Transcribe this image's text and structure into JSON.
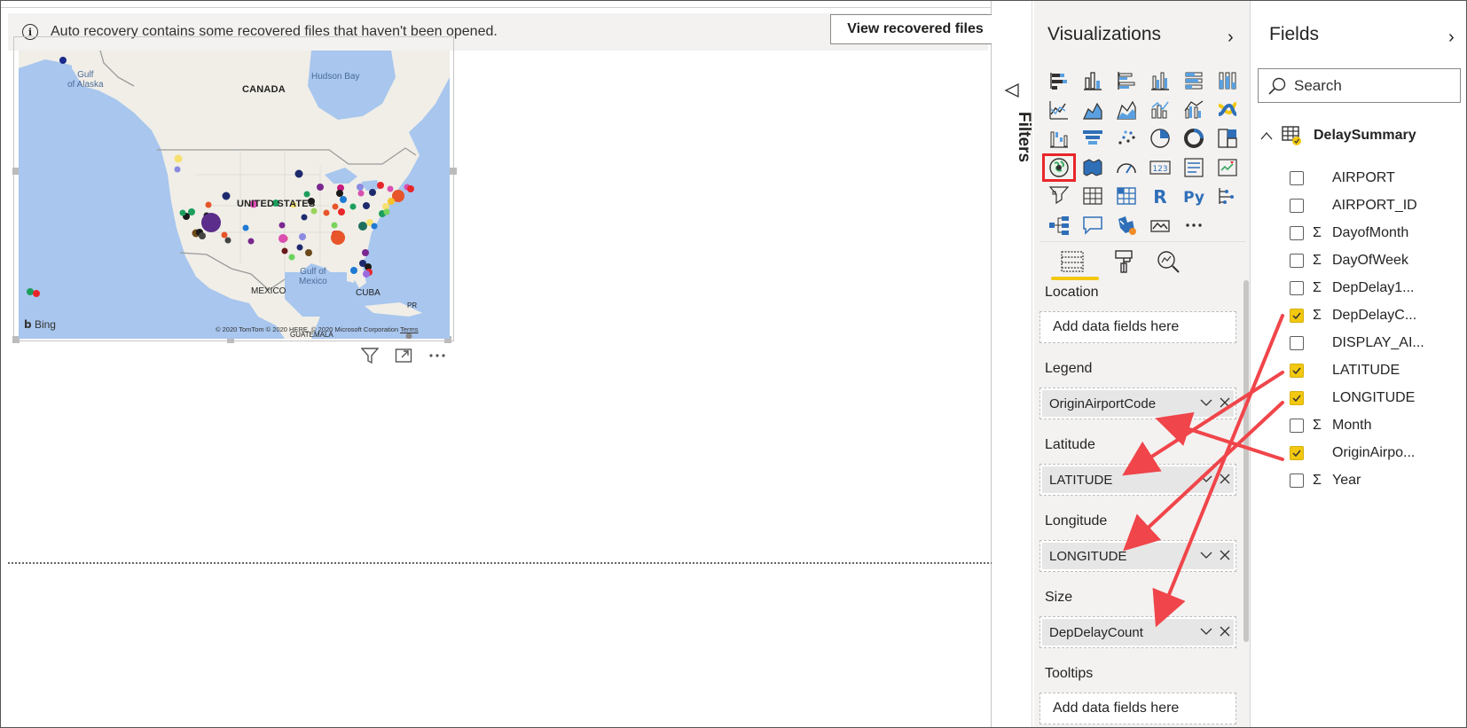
{
  "notification": {
    "message": "Auto recovery contains some recovered files that haven't been opened.",
    "button": "View recovered files"
  },
  "map": {
    "labels": {
      "canada": "CANADA",
      "us": "UNITED STATES",
      "mexico": "MEXICO",
      "cuba": "CUBA",
      "gulf_alaska": "Gulf\nof Alaska",
      "hudson": "Hudson Bay",
      "gulf_mexico": "Gulf of\nMexico",
      "guatemala": "GUATEMALA",
      "pr": "PR"
    },
    "copyright": "© 2020 TomTom © 2020 HERE, © 2020 Microsoft Corporation",
    "terms": "Terms",
    "bing": "Bing"
  },
  "filters": {
    "label": "Filters"
  },
  "visualizations": {
    "title": "Visualizations",
    "icons": [
      "stacked-bar",
      "stacked-column",
      "clustered-bar",
      "clustered-column",
      "100-bar",
      "100-column",
      "line",
      "area",
      "stacked-area",
      "line-column",
      "line-clustered",
      "ribbon",
      "waterfall",
      "funnel",
      "scatter",
      "pie",
      "donut",
      "treemap",
      "map",
      "filled-map",
      "gauge",
      "card",
      "multirow-card",
      "kpi",
      "slicer",
      "table",
      "matrix",
      "r-visual",
      "python-visual",
      "key-influencers",
      "decomposition-tree",
      "qa",
      "shape-map",
      "arcgis",
      "more"
    ],
    "selected_icon": "map",
    "wells": {
      "location": {
        "label": "Location",
        "placeholder": "Add data fields here"
      },
      "legend": {
        "label": "Legend",
        "value": "OriginAirportCode"
      },
      "latitude": {
        "label": "Latitude",
        "value": "LATITUDE"
      },
      "longitude": {
        "label": "Longitude",
        "value": "LONGITUDE"
      },
      "size": {
        "label": "Size",
        "value": "DepDelayCount"
      },
      "tooltips": {
        "label": "Tooltips",
        "placeholder": "Add data fields here"
      }
    }
  },
  "fields": {
    "title": "Fields",
    "search_placeholder": "Search",
    "table": "DelaySummary",
    "items": [
      {
        "name": "AIRPORT",
        "checked": false,
        "sigma": false
      },
      {
        "name": "AIRPORT_ID",
        "checked": false,
        "sigma": false
      },
      {
        "name": "DayofMonth",
        "checked": false,
        "sigma": true
      },
      {
        "name": "DayOfWeek",
        "checked": false,
        "sigma": true
      },
      {
        "name": "DepDelay1...",
        "checked": false,
        "sigma": true
      },
      {
        "name": "DepDelayC...",
        "checked": true,
        "sigma": true
      },
      {
        "name": "DISPLAY_AI...",
        "checked": false,
        "sigma": false
      },
      {
        "name": "LATITUDE",
        "checked": true,
        "sigma": false
      },
      {
        "name": "LONGITUDE",
        "checked": true,
        "sigma": false
      },
      {
        "name": "Month",
        "checked": false,
        "sigma": true
      },
      {
        "name": "OriginAirpo...",
        "checked": true,
        "sigma": false
      },
      {
        "name": "Year",
        "checked": false,
        "sigma": true
      }
    ],
    "sigma_symbol": "Σ"
  },
  "colors": {
    "accent_yellow": "#f2c811",
    "annotation_red": "#e8262a",
    "pane_bg": "#f3f2f1",
    "map_water": "#a8c6ee"
  }
}
